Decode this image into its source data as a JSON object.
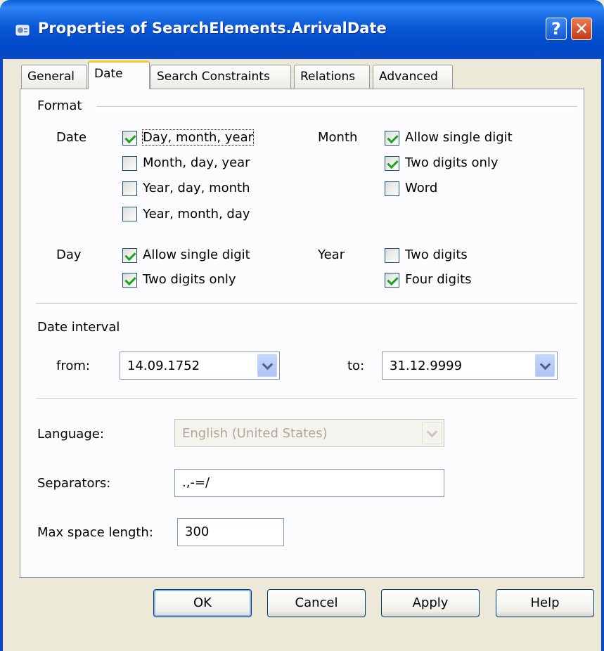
{
  "window": {
    "title": "Properties of SearchElements.ArrivalDate",
    "help_label": "?",
    "close_label": "✕"
  },
  "tabs": [
    {
      "label": "General",
      "active": false
    },
    {
      "label": "Date",
      "active": true
    },
    {
      "label": "Search Constraints",
      "active": false
    },
    {
      "label": "Relations",
      "active": false
    },
    {
      "label": "Advanced",
      "active": false
    }
  ],
  "format": {
    "section_label": "Format",
    "date": {
      "label": "Date",
      "options": [
        {
          "label": "Day, month, year",
          "checked": true
        },
        {
          "label": "Month, day, year",
          "checked": false
        },
        {
          "label": "Year, day, month",
          "checked": false
        },
        {
          "label": "Year, month, day",
          "checked": false
        }
      ]
    },
    "month": {
      "label": "Month",
      "options": [
        {
          "label": "Allow single digit",
          "checked": true
        },
        {
          "label": "Two digits only",
          "checked": true
        },
        {
          "label": "Word",
          "checked": false
        }
      ]
    },
    "day": {
      "label": "Day",
      "options": [
        {
          "label": "Allow single digit",
          "checked": true
        },
        {
          "label": "Two digits only",
          "checked": true
        }
      ]
    },
    "year": {
      "label": "Year",
      "options": [
        {
          "label": "Two digits",
          "checked": false
        },
        {
          "label": "Four digits",
          "checked": true
        }
      ]
    }
  },
  "date_interval": {
    "section_label": "Date interval",
    "from_label": "from:",
    "from_value": "14.09.1752",
    "to_label": "to:",
    "to_value": "31.12.9999"
  },
  "language": {
    "label": "Language:",
    "value": "English (United States)",
    "disabled": true
  },
  "separators": {
    "label": "Separators:",
    "value": ".,-=/"
  },
  "max_space": {
    "label": "Max space length:",
    "value": "300"
  },
  "buttons": {
    "ok": "OK",
    "cancel": "Cancel",
    "apply": "Apply",
    "help": "Help"
  },
  "colors": {
    "titlebar": "#0a58d6",
    "check": "#21a121",
    "active_tab_accent": "#ffc83c"
  }
}
